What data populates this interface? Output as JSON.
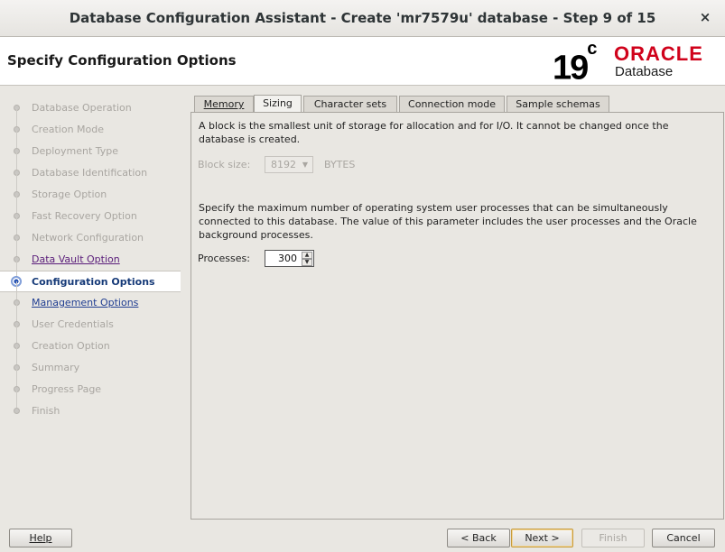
{
  "window": {
    "title": "Database Configuration Assistant - Create 'mr7579u' database - Step 9 of 15",
    "close_glyph": "×"
  },
  "header": {
    "page_title": "Specify Configuration Options",
    "logo": {
      "version": "19",
      "version_sup": "c",
      "brand": "ORACLE",
      "product": "Database"
    }
  },
  "sidebar": {
    "items": [
      {
        "label": "Database Operation",
        "state": "done"
      },
      {
        "label": "Creation Mode",
        "state": "done"
      },
      {
        "label": "Deployment Type",
        "state": "done"
      },
      {
        "label": "Database Identification",
        "state": "done"
      },
      {
        "label": "Storage Option",
        "state": "done"
      },
      {
        "label": "Fast Recovery Option",
        "state": "done"
      },
      {
        "label": "Network Configuration",
        "state": "done"
      },
      {
        "label": "Data Vault Option",
        "state": "link"
      },
      {
        "label": "Configuration Options",
        "state": "current"
      },
      {
        "label": "Management Options",
        "state": "next"
      },
      {
        "label": "User Credentials",
        "state": "pending"
      },
      {
        "label": "Creation Option",
        "state": "pending"
      },
      {
        "label": "Summary",
        "state": "pending"
      },
      {
        "label": "Progress Page",
        "state": "pending"
      },
      {
        "label": "Finish",
        "state": "pending"
      }
    ]
  },
  "tabs": [
    {
      "label": "Memory",
      "mnemonic_index": 0
    },
    {
      "label": "Sizing",
      "mnemonic_index": 0,
      "active": true
    },
    {
      "label": "Character sets",
      "mnemonic_index": 0
    },
    {
      "label": "Connection mode",
      "mnemonic_index": 1
    },
    {
      "label": "Sample schemas",
      "mnemonic_index": 5
    }
  ],
  "sizing": {
    "block_desc": "A block is the smallest unit of storage for allocation and for I/O. It cannot be changed once the database is created.",
    "block_size_label": "Block size:",
    "block_size_value": "8192",
    "block_size_unit": "BYTES",
    "processes_desc": "Specify the maximum number of operating system user processes that can be simultaneously connected to this database. The value of this parameter includes the user processes and the Oracle background processes.",
    "processes_label": "Processes:",
    "processes_value": "300"
  },
  "footer": {
    "help": "Help",
    "back": "< Back",
    "next": "Next >",
    "finish": "Finish",
    "cancel": "Cancel"
  }
}
